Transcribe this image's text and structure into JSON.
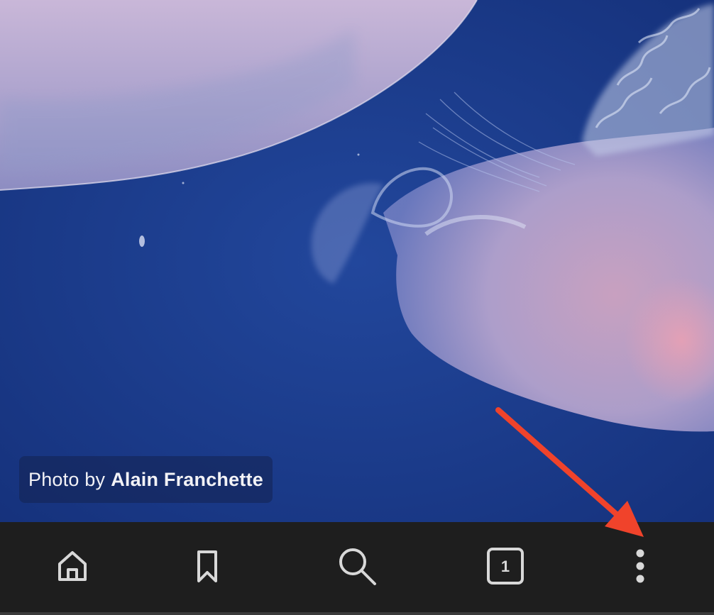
{
  "photo": {
    "credit_prefix": "Photo by",
    "credit_author": "Alain Franchette",
    "background_color": "#1d3a8c"
  },
  "toolbar": {
    "background_color": "#1e1e1e",
    "icon_color": "#d8d8d8",
    "buttons": [
      {
        "name": "home",
        "icon": "home-icon"
      },
      {
        "name": "bookmarks",
        "icon": "bookmark-icon"
      },
      {
        "name": "search",
        "icon": "search-icon"
      },
      {
        "name": "tabs",
        "icon": "tab-switcher-icon",
        "count": "1"
      },
      {
        "name": "more",
        "icon": "more-vertical-icon"
      }
    ]
  },
  "annotation": {
    "type": "red-arrow",
    "color": "#f0432b",
    "points_to": "more-vertical-icon"
  }
}
